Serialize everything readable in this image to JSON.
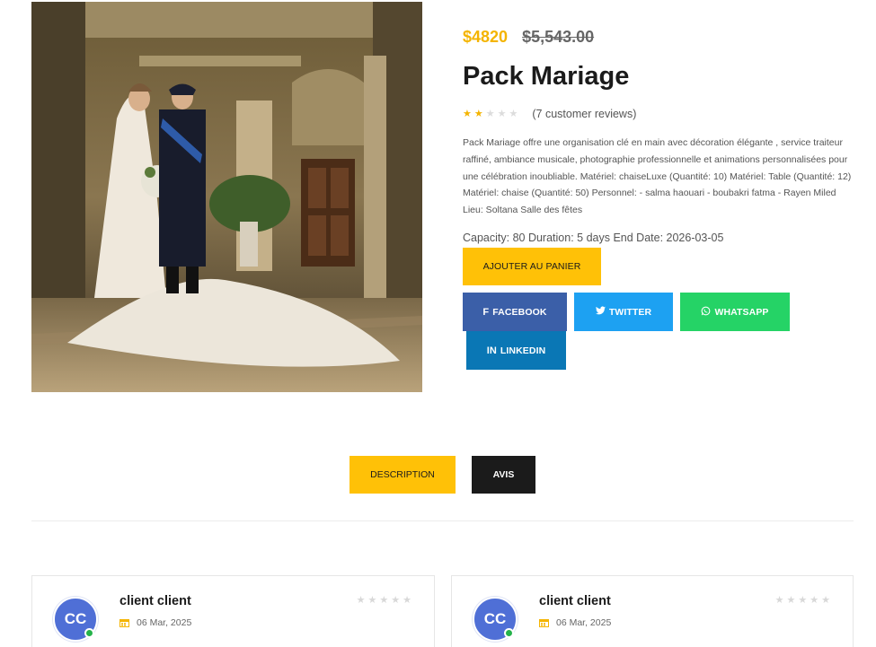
{
  "product": {
    "price_new": "$4820",
    "price_old": "$5,543.00",
    "title": "Pack Mariage",
    "rating": 2,
    "rating_max": 5,
    "reviews_text": "(7 customer reviews)",
    "description": "Pack Mariage offre une organisation clé en main avec décoration élégante , service traiteur raffiné, ambiance musicale, photographie professionnelle et animations personnalisées pour une célébration inoubliable. Matériel: chaiseLuxe (Quantité: 10) Matériel: Table (Quantité: 12) Matériel: chaise (Quantité: 50) Personnel: - salma haouari - boubakri fatma - Rayen Miled Lieu: Soltana Salle des fêtes",
    "meta": "Capacity: 80 Duration: 5 days End Date: 2026-03-05",
    "cart_label": "AJOUTER AU PANIER"
  },
  "share": {
    "facebook": "FACEBOOK",
    "twitter": "TWITTER",
    "whatsapp": "WHATSAPP",
    "linkedin": "LINKEDIN"
  },
  "tabs": {
    "description": "DESCRIPTION",
    "avis": "AVIS"
  },
  "reviews": [
    {
      "initials": "CC",
      "name": "client client",
      "date": "06 Mar, 2025",
      "rating": 0
    },
    {
      "initials": "CC",
      "name": "client client",
      "date": "06 Mar, 2025",
      "rating": 0
    }
  ],
  "colors": {
    "accent": "#ffc107",
    "price": "#f4b400",
    "facebook": "#3b5fa8",
    "twitter": "#1da1f2",
    "whatsapp": "#25d366",
    "linkedin": "#0a77b5",
    "avatar": "#4f6fd6"
  },
  "icons": {
    "facebook": "facebook-icon",
    "twitter": "twitter-icon",
    "whatsapp": "whatsapp-icon",
    "linkedin": "linkedin-icon",
    "calendar": "calendar-icon",
    "star": "star-icon"
  }
}
